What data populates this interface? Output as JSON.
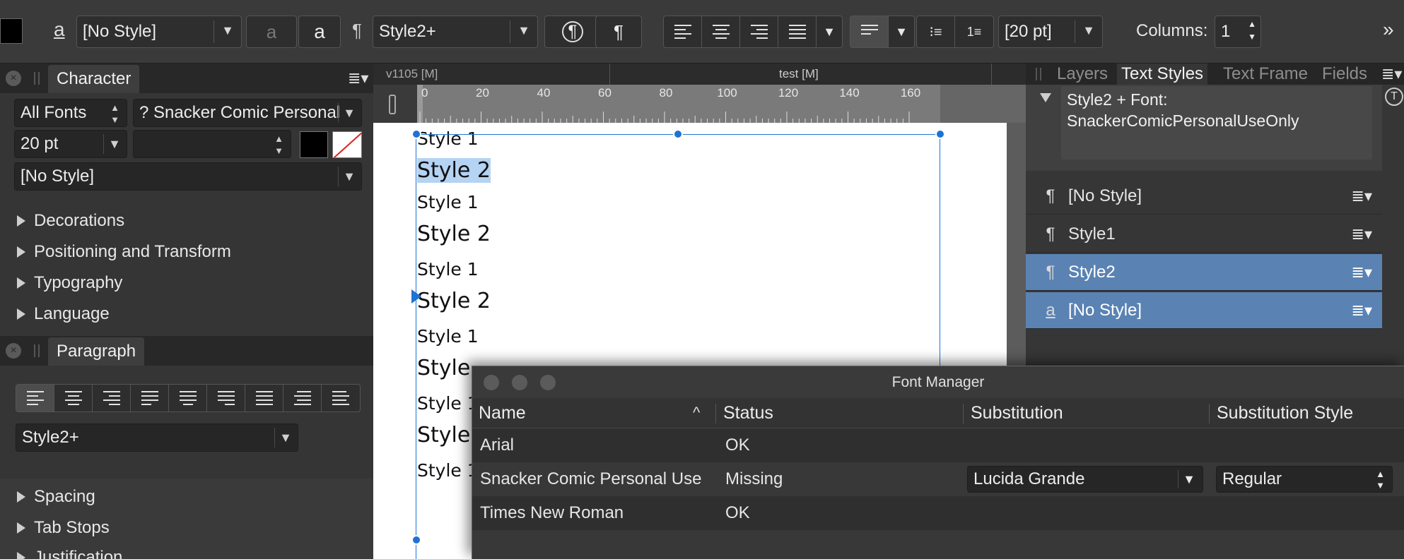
{
  "toolbar": {
    "char_style": "[No Style]",
    "para_style": "Style2+",
    "leading": "[20 pt]",
    "columns_label": "Columns:",
    "columns_value": "1",
    "more": "»"
  },
  "character_panel": {
    "title": "Character",
    "font_collection": "All Fonts",
    "font_name": "? Snacker Comic Personal",
    "font_size": "20 pt",
    "font_style": "",
    "char_style": "[No Style]",
    "sections": [
      "Decorations",
      "Positioning and Transform",
      "Typography",
      "Language"
    ]
  },
  "paragraph_panel": {
    "title": "Paragraph",
    "style": "Style2+",
    "sections": [
      "Spacing",
      "Tab Stops",
      "Justification"
    ]
  },
  "document": {
    "tabs": [
      "v1105  [M]",
      "test [M]"
    ],
    "ruler_ticks": [
      "0",
      "20",
      "40",
      "60",
      "80",
      "100",
      "120",
      "140",
      "160"
    ],
    "lines": [
      {
        "text": "Style 1",
        "style": "s1",
        "selected": false
      },
      {
        "text": "Style 2",
        "style": "s2",
        "selected": true
      },
      {
        "text": "Style 1",
        "style": "s1",
        "selected": false
      },
      {
        "text": "Style 2",
        "style": "s2",
        "selected": false
      },
      {
        "text": "Style 1",
        "style": "s1",
        "selected": false
      },
      {
        "text": "Style 2",
        "style": "s2",
        "selected": false
      },
      {
        "text": "Style 1",
        "style": "s1",
        "selected": false
      },
      {
        "text": "Style",
        "style": "s2",
        "selected": false
      },
      {
        "text": "Style 1",
        "style": "s1",
        "selected": false
      },
      {
        "text": "Style",
        "style": "s2",
        "selected": false
      },
      {
        "text": "Style 1",
        "style": "s1",
        "selected": false
      }
    ]
  },
  "right_panel": {
    "tabs": [
      "Layers",
      "Text Styles",
      "Text Frame",
      "Fields"
    ],
    "active_tab": "Text Styles",
    "preview_text": "Style2 + Font: SnackerComicPersonalUseOnly",
    "styles": [
      {
        "glyph": "¶",
        "name": "[No Style]",
        "selected": false
      },
      {
        "glyph": "¶",
        "name": "Style1",
        "selected": false
      },
      {
        "glyph": "¶",
        "name": "Style2",
        "selected": true
      },
      {
        "glyph": "a",
        "name": "[No Style]",
        "selected": true
      }
    ]
  },
  "font_manager": {
    "title": "Font Manager",
    "columns": [
      "Name",
      "Status",
      "Substitution",
      "Substitution Style"
    ],
    "rows": [
      {
        "name": "Arial",
        "status": "OK",
        "substitution": "",
        "substitution_style": ""
      },
      {
        "name": "Snacker Comic Personal Use",
        "status": "Missing",
        "substitution": "Lucida Grande",
        "substitution_style": "Regular"
      },
      {
        "name": "Times New Roman",
        "status": "OK",
        "substitution": "",
        "substitution_style": ""
      }
    ]
  }
}
